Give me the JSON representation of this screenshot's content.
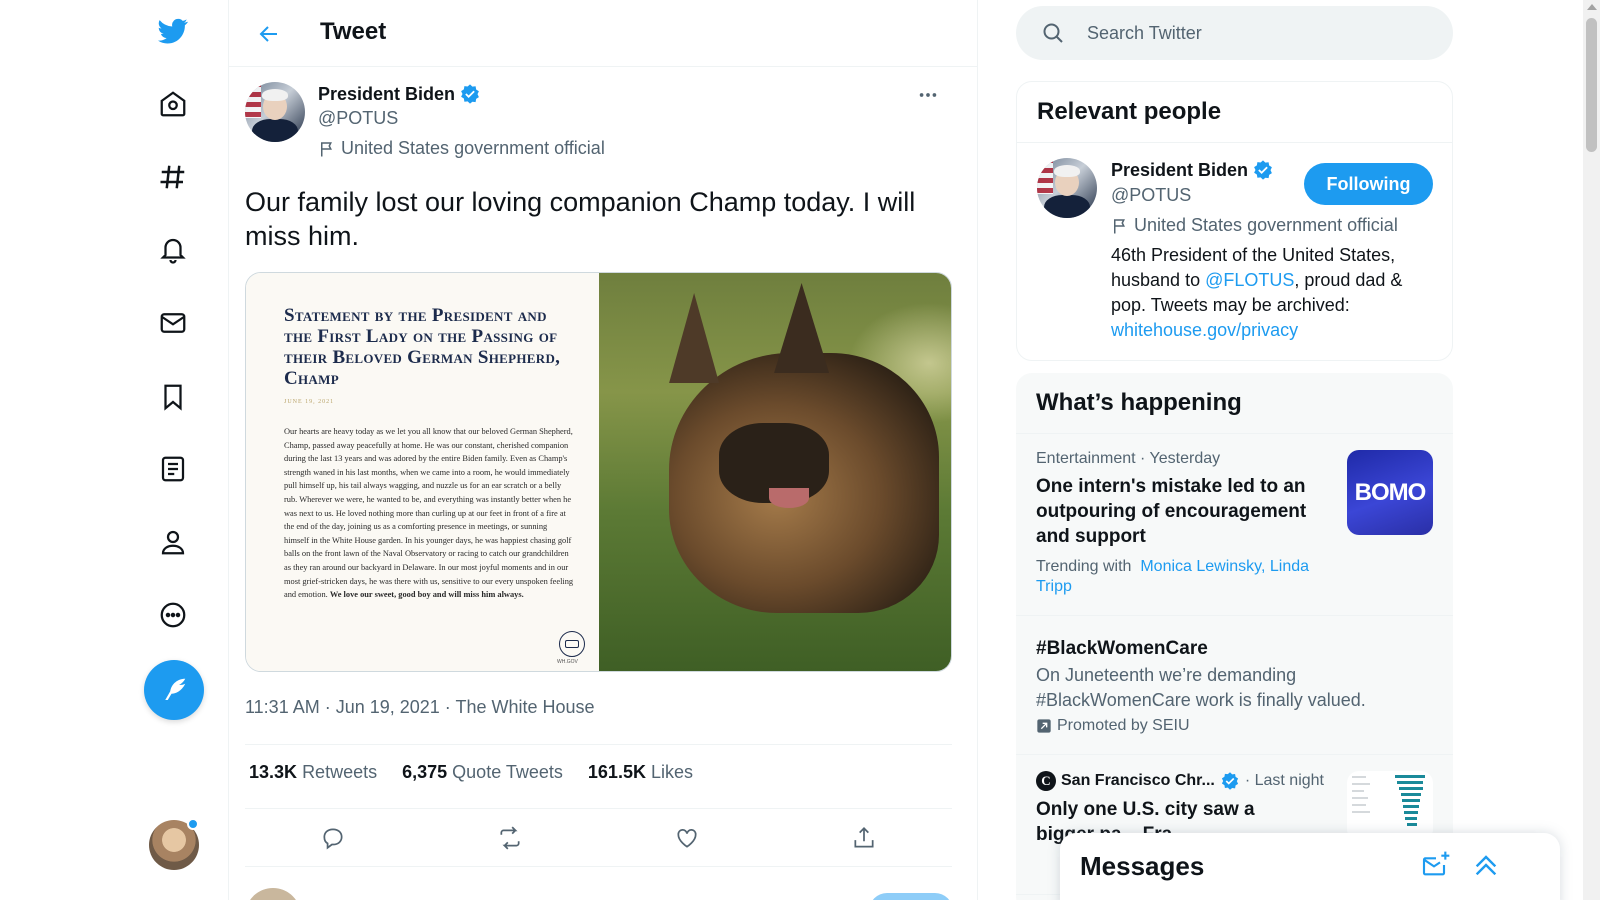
{
  "nav": {
    "items": [
      "twitter-logo",
      "home-icon",
      "explore-icon",
      "notifications-icon",
      "messages-icon",
      "bookmarks-icon",
      "lists-icon",
      "profile-icon",
      "more-icon"
    ],
    "compose_icon": "compose-tweet-icon"
  },
  "header": {
    "title": "Tweet"
  },
  "tweet": {
    "author_name": "President Biden",
    "author_handle": "@POTUS",
    "author_label": "United States government official",
    "text": "Our family lost our loving companion Champ today. I will miss him.",
    "statement": {
      "title": "Statement by the President and the First Lady on the Passing of their Beloved German Shepherd, Champ",
      "date": "JUNE 19, 2021",
      "body": "Our hearts are heavy today as we let you all know that our beloved German Shepherd, Champ, passed away peacefully at home. He was our constant, cherished companion during the last 13 years and was adored by the entire Biden family. Even as Champ's strength waned in his last months, when we came into a room, he would immediately pull himself up, his tail always wagging, and nuzzle us for an ear scratch or a belly rub. Wherever we were, he wanted to be, and everything was instantly better when he was next to us. He loved nothing more than curling up at our feet in front of a fire at the end of the day, joining us as a comforting presence in meetings, or sunning himself in the White House garden. In his younger days, he was happiest chasing golf balls on the front lawn of the Naval Observatory or racing to catch our grandchildren as they ran around our backyard in Delaware. In our most joyful moments and in our most grief-stricken days, he was there with us, sensitive to our every unspoken feeling and emotion.",
      "closing": "We love our sweet, good boy and will miss him always.",
      "footer": "WH.GOV"
    },
    "time": "11:31 AM · Jun 19, 2021 · ",
    "source": "The White House",
    "retweets": "13.3K",
    "retweets_label": "Retweets",
    "quotes": "6,375",
    "quotes_label": "Quote Tweets",
    "likes": "161.5K",
    "likes_label": "Likes"
  },
  "search": {
    "placeholder": "Search Twitter"
  },
  "relevant": {
    "title": "Relevant people",
    "name": "President Biden",
    "handle": "@POTUS",
    "label": "United States government official",
    "follow_label": "Following",
    "bio_1": "46th President of the United States, husband to ",
    "bio_link_1": "@FLOTUS",
    "bio_2": ", proud dad & pop. Tweets may be archived: ",
    "bio_link_2": "whitehouse.gov/privacy"
  },
  "happening": {
    "title": "What’s happening",
    "trends": [
      {
        "meta": "Entertainment · Yesterday",
        "title": "One intern's mistake led to an outpouring of encouragement and support",
        "trending_prefix": "Trending with",
        "trending_with": "Monica Lewinsky, Linda Tripp",
        "thumb_text": "BOMO"
      },
      {
        "title": "#BlackWomenCare",
        "desc": "On Juneteenth we’re demanding #BlackWomenCare work is finally valued.",
        "promoted": "Promoted by SEIU"
      },
      {
        "source": "San Francisco Chr...",
        "time": "· Last night",
        "title": "Only one U.S. city saw a bigger pa... Fra..."
      }
    ]
  },
  "messages": {
    "title": "Messages"
  },
  "colors": {
    "accent": "#1d9bf0",
    "text": "#0f1419",
    "muted": "#536471"
  }
}
